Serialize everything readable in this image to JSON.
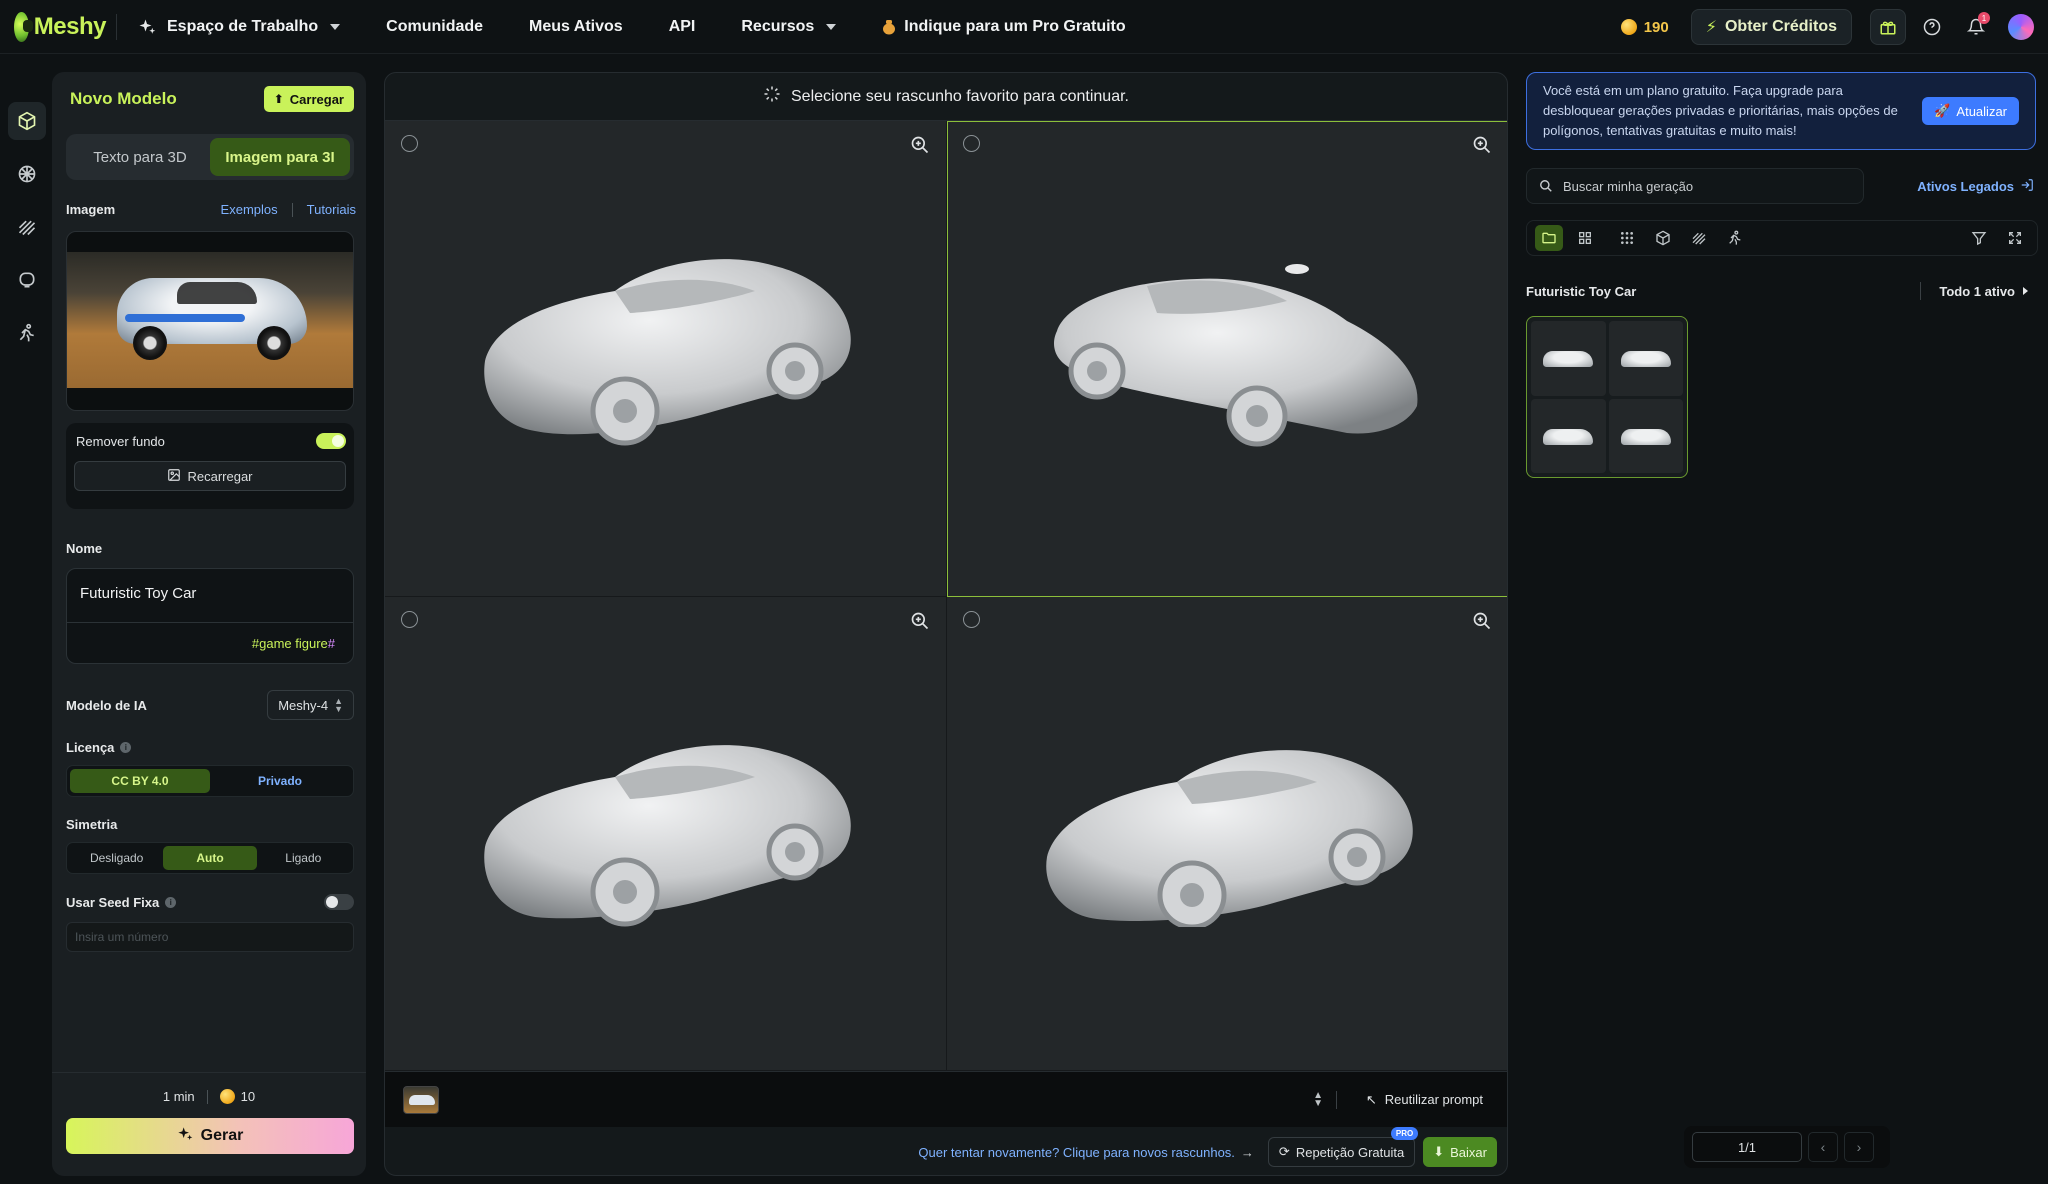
{
  "brand": {
    "name": "Meshy"
  },
  "nav": {
    "workspace": "Espaço de Trabalho",
    "community": "Comunidade",
    "my_assets": "Meus Ativos",
    "api": "API",
    "resources": "Recursos",
    "referral": "Indique para um Pro Gratuito",
    "credits": "190",
    "get_credits": "Obter Créditos",
    "notifications_count": "1"
  },
  "rail": {
    "items": [
      "cube-icon",
      "texture-icon",
      "stripes-icon",
      "chat-icon",
      "run-icon"
    ]
  },
  "left": {
    "title": "Novo Modelo",
    "upload": "Carregar",
    "tabs": [
      "Texto para 3D",
      "Imagem para 3I"
    ],
    "active_tab": 1,
    "image_label": "Imagem",
    "examples": "Exemplos",
    "tutorials": "Tutoriais",
    "remove_bg": "Remover fundo",
    "remove_bg_on": true,
    "reload": "Recarregar",
    "name_label": "Nome",
    "name_value": "Futuristic Toy Car",
    "tag_game": "#game figure",
    "tag_hash": "#",
    "ai_model_label": "Modelo de IA",
    "ai_model_value": "Meshy-4",
    "license_label": "Licença",
    "license_options": [
      "CC BY 4.0",
      "Privado"
    ],
    "symmetry_label": "Simetria",
    "symmetry_options": [
      "Desligado",
      "Auto",
      "Ligado"
    ],
    "seed_label": "Usar Seed Fixa",
    "seed_on": false,
    "seed_placeholder": "Insira um número",
    "time": "1 min",
    "cost": "10",
    "generate": "Gerar"
  },
  "center": {
    "header": "Selecione seu rascunho favorito para continuar.",
    "selected_cell": 1,
    "reuse_prompt": "Reutilizar prompt",
    "retry_text": "Quer tentar novamente? Clique para novos rascunhos.",
    "free_retry": "Repetição Gratuita",
    "pro_badge": "PRO",
    "download": "Baixar"
  },
  "right": {
    "upgrade_text": "Você está em um plano gratuito. Faça upgrade para desbloquear gerações privadas e prioritárias, mais opções de polígonos, tentativas gratuitas e muito mais!",
    "upgrade_btn": "Atualizar",
    "search_placeholder": "Buscar minha geração",
    "legacy": "Ativos Legados",
    "group_title": "Futuristic Toy Car",
    "group_count": "Todo 1 ativo",
    "pager": "1/1"
  },
  "colors": {
    "accent": "#c9f25a",
    "selected_green": "#365a17",
    "link_blue": "#7fb2ff",
    "info_blue": "#3d7bff"
  }
}
